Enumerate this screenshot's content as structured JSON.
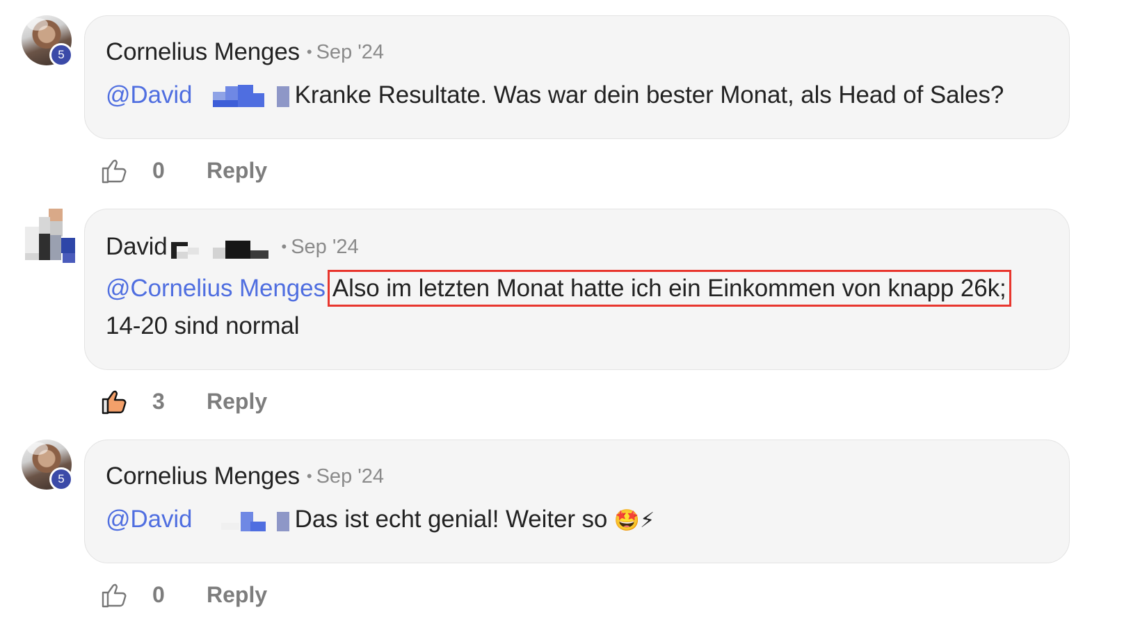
{
  "comments": [
    {
      "author": "Cornelius Menges",
      "time": "Sep '24",
      "level": "5",
      "mention": "@David",
      "text": "Kranke Resultate. Was war dein bester Monat, als Head of Sales?",
      "likes": "0",
      "liked": false,
      "reply_label": "Reply"
    },
    {
      "author": "David",
      "time": "Sep '24",
      "mention": "@Cornelius Menges",
      "text_highlighted": "Also im letzten Monat hatte ich ein Einkommen von knapp 26k;",
      "text_continued": "14-20 sind normal",
      "likes": "3",
      "liked": true,
      "reply_label": "Reply"
    },
    {
      "author": "Cornelius Menges",
      "time": "Sep '24",
      "level": "5",
      "mention": "@David",
      "text": "Das ist echt genial! Weiter so",
      "emoji": "🤩⚡",
      "likes": "0",
      "liked": false,
      "reply_label": "Reply"
    }
  ],
  "separator": "•",
  "colors": {
    "mention": "#4f6ee0",
    "highlight_border": "#e8362e",
    "level_badge": "#3b4aa8",
    "bubble_bg": "#f5f5f5"
  },
  "icons": {
    "like": "thumbs-up-icon",
    "like_active": "thumbs-up-filled-icon"
  }
}
